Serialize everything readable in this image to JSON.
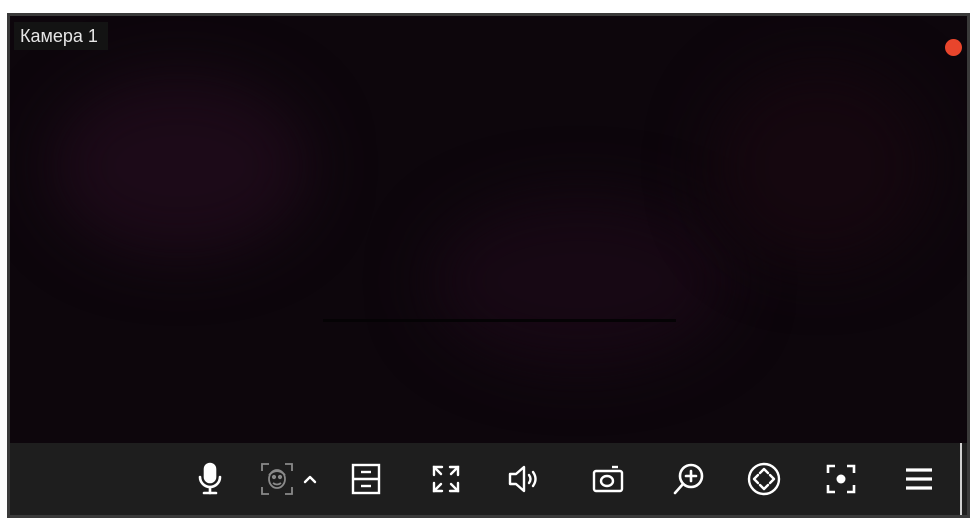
{
  "camera": {
    "name": "Камера 1",
    "recording": true,
    "record_color": "#e8452c"
  },
  "toolbar": {
    "icon_color": "#ffffff",
    "buttons": [
      {
        "id": "microphone",
        "icon": "microphone-icon"
      },
      {
        "id": "face-detection",
        "icon": "face-frame-icon"
      },
      {
        "id": "face-expand",
        "icon": "chevron-up-icon"
      },
      {
        "id": "archive",
        "icon": "archive-drawer-icon"
      },
      {
        "id": "fullscreen",
        "icon": "expand-arrows-icon"
      },
      {
        "id": "sound",
        "icon": "speaker-icon"
      },
      {
        "id": "snapshot",
        "icon": "camera-icon"
      },
      {
        "id": "digital-zoom",
        "icon": "zoom-in-icon"
      },
      {
        "id": "ptz",
        "icon": "ptz-arrows-icon"
      },
      {
        "id": "focus",
        "icon": "focus-frame-icon"
      },
      {
        "id": "menu",
        "icon": "menu-icon"
      }
    ]
  }
}
